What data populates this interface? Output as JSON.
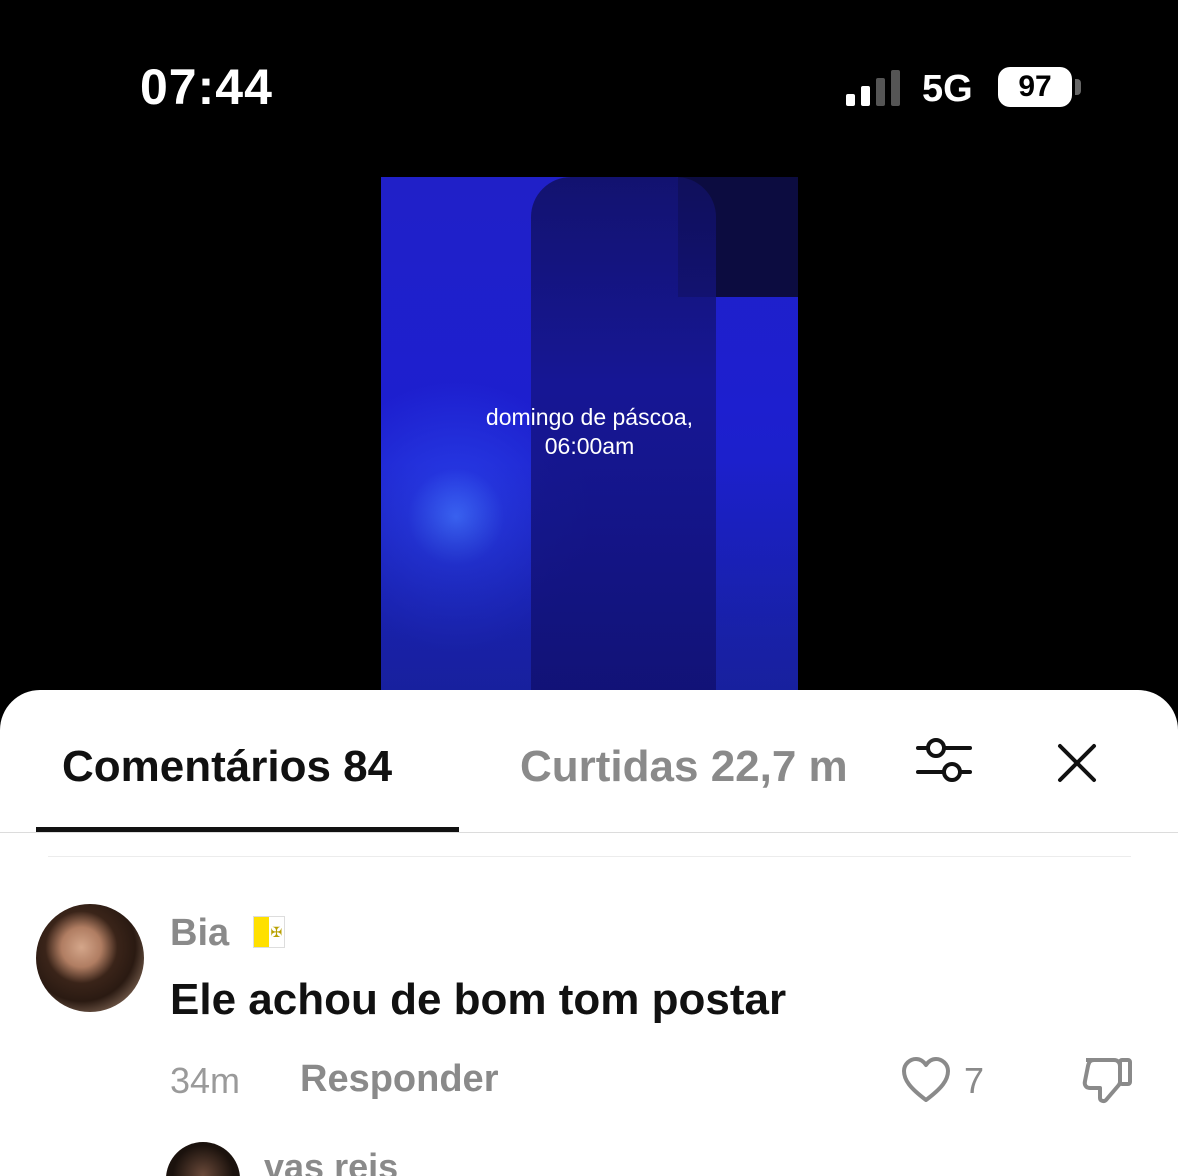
{
  "status_bar": {
    "time": "07:44",
    "network": "5G",
    "battery": "97"
  },
  "video": {
    "caption_line1": "domingo de páscoa,",
    "caption_line2": "06:00am"
  },
  "tabs": {
    "comments": "Comentários 84",
    "likes": "Curtidas 22,7 m"
  },
  "comments": [
    {
      "username": "Bia",
      "flag": "🇻🇦",
      "text": "Ele achou de bom tom postar",
      "time": "34m",
      "reply_label": "Responder",
      "likes": "7"
    },
    {
      "username": "vas reis"
    }
  ],
  "icons": {
    "filter": "sliders-icon",
    "close": "close-icon",
    "like": "heart-icon",
    "dislike": "thumbs-down-icon"
  },
  "colors": {
    "sheet_bg": "#ffffff",
    "video_blue": "#1e22cc",
    "muted_text": "#8a8a8a"
  }
}
